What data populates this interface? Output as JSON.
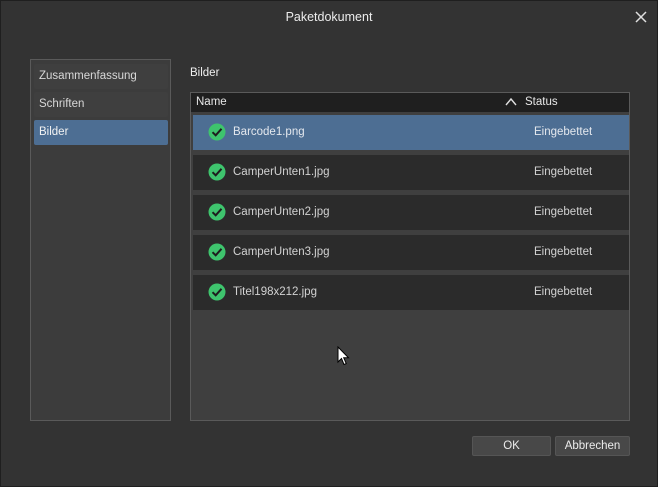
{
  "window": {
    "title": "Paketdokument"
  },
  "sidebar": {
    "items": [
      {
        "label": "Zusammenfassung",
        "active": false
      },
      {
        "label": "Schriften",
        "active": false
      },
      {
        "label": "Bilder",
        "active": true
      }
    ]
  },
  "section": {
    "label": "Bilder"
  },
  "table": {
    "columns": {
      "name": "Name",
      "status": "Status"
    },
    "sort": "ascending",
    "rows": [
      {
        "name": "Barcode1.png",
        "status": "Eingebettet",
        "selected": true
      },
      {
        "name": "CamperUnten1.jpg",
        "status": "Eingebettet",
        "selected": false
      },
      {
        "name": "CamperUnten2.jpg",
        "status": "Eingebettet",
        "selected": false
      },
      {
        "name": "CamperUnten3.jpg",
        "status": "Eingebettet",
        "selected": false
      },
      {
        "name": "Titel198x212.jpg",
        "status": "Eingebettet",
        "selected": false
      }
    ]
  },
  "buttons": {
    "ok": "OK",
    "cancel": "Abbrechen"
  },
  "colors": {
    "accent": "#4d6e93",
    "check": "#3ec46d",
    "background": "#333333"
  },
  "icons": {
    "close": "close-icon",
    "sort": "sort-ascending-icon",
    "status": "check-circle-icon"
  }
}
